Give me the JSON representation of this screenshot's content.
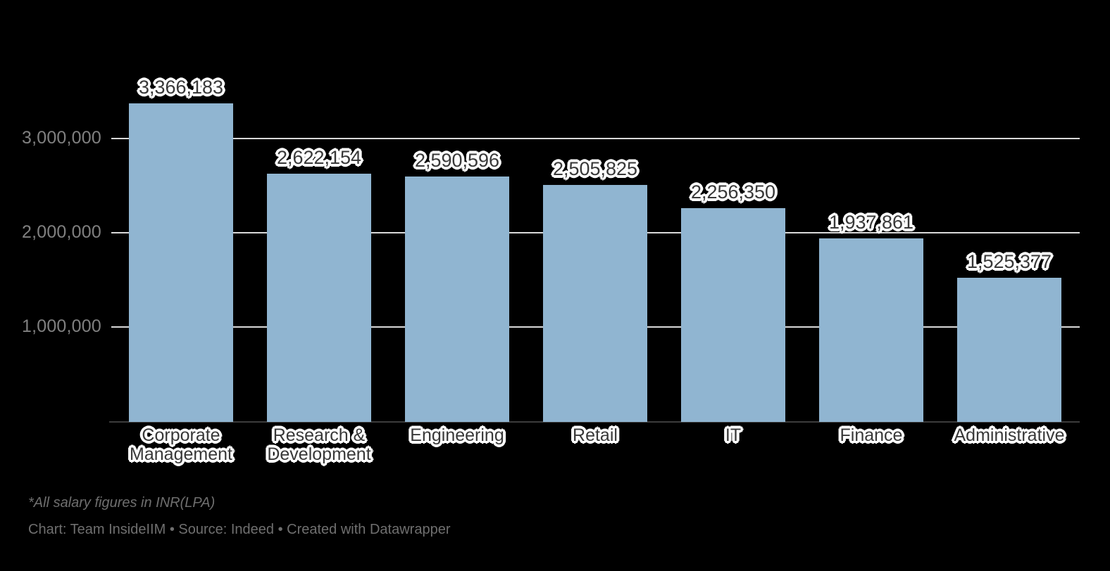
{
  "chart_data": {
    "type": "bar",
    "title": "",
    "subtitle": "",
    "xlabel": "",
    "ylabel": "",
    "categories": [
      "Corporate Management",
      "Research & Development",
      "Engineering",
      "Retail",
      "IT",
      "Finance",
      "Administrative"
    ],
    "category_lines": [
      [
        "Corporate",
        "Management"
      ],
      [
        "Research &",
        "Development"
      ],
      [
        "Engineering"
      ],
      [
        "Retail"
      ],
      [
        "IT"
      ],
      [
        "Finance"
      ],
      [
        "Administrative"
      ]
    ],
    "values": [
      3366183,
      2622154,
      2590596,
      2505825,
      2256350,
      1937861,
      1525377
    ],
    "value_labels": [
      "3,366,183",
      "2,622,154",
      "2,590,596",
      "2,505,825",
      "2,256,350",
      "1,937,861",
      "1,525,377"
    ],
    "ylim": [
      0,
      3366183
    ],
    "y_ticks": [
      1000000,
      2000000,
      3000000
    ],
    "y_tick_labels": [
      "1,000,000",
      "2,000,000",
      "3,000,000"
    ],
    "grid": true,
    "legend": null,
    "bar_color": "#90b5d1",
    "background_color": "#000000"
  },
  "footer": {
    "footnote": "*All salary figures in INR(LPA)",
    "credit": "Chart: Team InsideIIM • Source: Indeed • Created with Datawrapper"
  },
  "colors": {
    "bar": "#90b5d1",
    "background": "#000000",
    "gridline": "#d9d9d9",
    "axis": "#3c3c3c",
    "tick_text": "#808080",
    "label_text": "#383838",
    "label_halo": "#ffffff",
    "footer_text": "#6f6f6f"
  }
}
